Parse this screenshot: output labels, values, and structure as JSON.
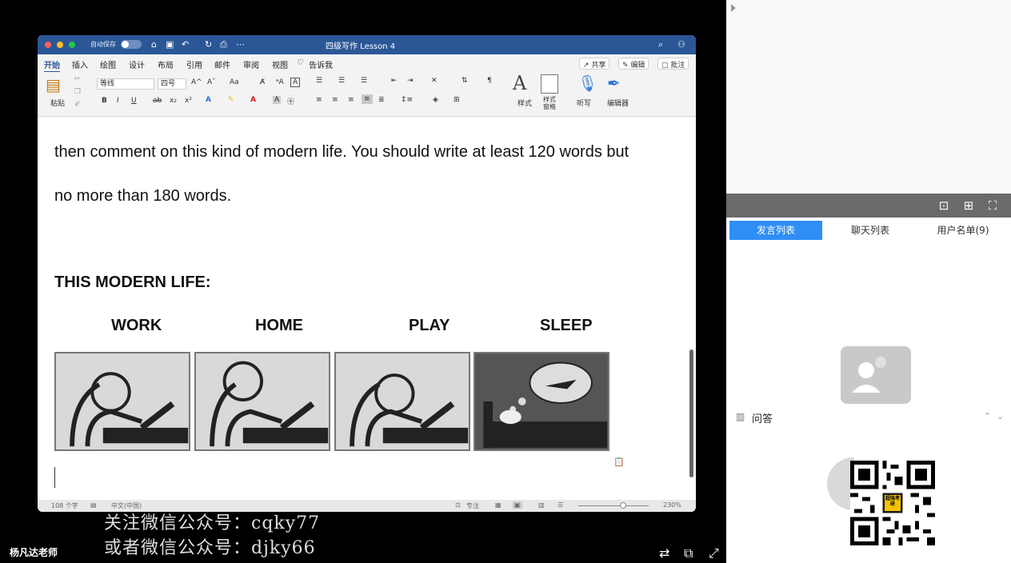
{
  "titlebar": {
    "autosave": "自动保存",
    "toggle": "关闭",
    "doc_title": "四级写作 Lesson 4"
  },
  "ribbon": {
    "tabs": [
      "开始",
      "插入",
      "绘图",
      "设计",
      "布局",
      "引用",
      "邮件",
      "审阅",
      "视图"
    ],
    "tell_me": "告诉我",
    "share": "共享",
    "edit": "编辑",
    "comment": "批注"
  },
  "toolbar": {
    "paste": "粘贴",
    "font": "等线",
    "size": "四号",
    "styles": "样式",
    "styles_pane": "样式窗格",
    "dictate": "听写",
    "editor": "编辑器"
  },
  "document": {
    "para1": "then comment on this kind of modern life. You should write at least 120 words but",
    "para2": "no more than 180 words.",
    "heading": "THIS MODERN LIFE:",
    "labels": [
      "WORK",
      "HOME",
      "PLAY",
      "SLEEP"
    ]
  },
  "statusbar": {
    "words": "108 个字",
    "language": "中文(中国)",
    "focus": "专注",
    "zoom": "230%"
  },
  "overlay": {
    "wechat1": "关注微信公众号：cqky77",
    "wechat2": "或者微信公众号：djky66",
    "teacher": "杨凡达老师"
  },
  "sidebar": {
    "tabs": [
      "发言列表",
      "聊天列表",
      "用户名单(9)"
    ],
    "active_tab": 0,
    "qa_title": "问答",
    "qr_badge": "超强考研"
  },
  "colors": {
    "word_blue": "#2b5797",
    "tab_active": "#2f8ef6"
  }
}
